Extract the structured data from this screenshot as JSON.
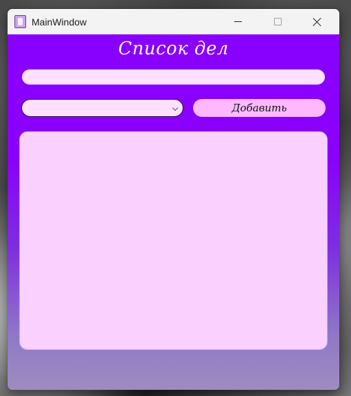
{
  "window": {
    "title": "MainWindow"
  },
  "app": {
    "heading": "Список дел",
    "task_input": {
      "value": "",
      "placeholder": ""
    },
    "category_select": {
      "selected": ""
    },
    "add_button_label": "Добавить",
    "task_list": {
      "items": []
    }
  },
  "colors": {
    "accent": "#8800ff",
    "field_background": "#fde0ff",
    "button_background": "#fdb8ff",
    "list_background": "#f9d0ff"
  },
  "icons": {
    "app": "notepad-icon",
    "minimize": "minimize-icon",
    "maximize": "maximize-icon",
    "close": "close-icon",
    "dropdown": "chevron-down-icon"
  }
}
